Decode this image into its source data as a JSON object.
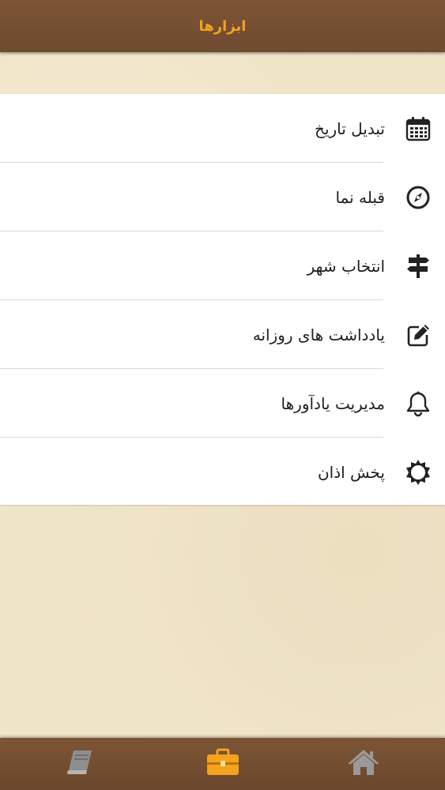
{
  "header": {
    "title": "ابزارها"
  },
  "menu": {
    "items": [
      {
        "label": "تبدیل تاریخ",
        "icon": "calendar-icon"
      },
      {
        "label": "قبله نما",
        "icon": "compass-icon"
      },
      {
        "label": "انتخاب شهر",
        "icon": "signpost-icon"
      },
      {
        "label": "یادداشت های روزانه",
        "icon": "edit-note-icon"
      },
      {
        "label": "مدیریت یادآورها",
        "icon": "bell-icon"
      },
      {
        "label": "پخش اذان",
        "icon": "sun-icon"
      }
    ]
  },
  "tabbar": {
    "tabs": [
      {
        "icon": "book-icon",
        "active": false
      },
      {
        "icon": "briefcase-icon",
        "active": true
      },
      {
        "icon": "home-icon",
        "active": false
      }
    ]
  },
  "colors": {
    "bar_brown": "#765033",
    "accent_orange": "#f5a21c",
    "paper": "#f1e5c8"
  }
}
